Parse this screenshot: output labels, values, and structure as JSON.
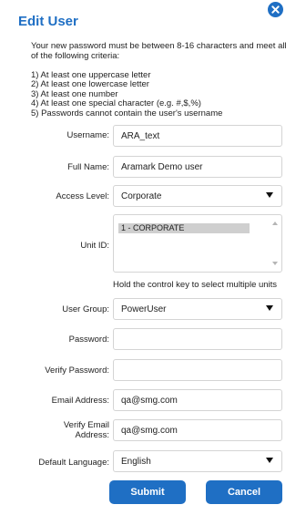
{
  "dialog": {
    "title": "Edit User",
    "intro": "Your new password must be between 8-16 characters and meet all of the following criteria:",
    "rules": [
      "1) At least one uppercase letter",
      "2) At least one lowercase letter",
      "3) At least one number",
      "4) At least one special character (e.g. #,$,%)",
      "5) Passwords cannot contain the user's username"
    ]
  },
  "form": {
    "username": {
      "label": "Username:",
      "value": "ARA_text"
    },
    "full_name": {
      "label": "Full Name:",
      "value": "Aramark Demo user"
    },
    "access_level": {
      "label": "Access Level:",
      "value": "Corporate"
    },
    "unit_id": {
      "label": "Unit ID:",
      "options": [
        "1 - CORPORATE"
      ],
      "hint": "Hold the control key to select multiple units"
    },
    "user_group": {
      "label": "User Group:",
      "value": "PowerUser"
    },
    "password": {
      "label": "Password:",
      "value": ""
    },
    "verify_password": {
      "label": "Verify Password:",
      "value": ""
    },
    "email": {
      "label": "Email Address:",
      "value": "qa@smg.com"
    },
    "verify_email": {
      "label_line1": "Verify Email",
      "label_line2": "Address:",
      "value": "qa@smg.com"
    },
    "default_language": {
      "label": "Default Language:",
      "value": "English"
    }
  },
  "buttons": {
    "submit": "Submit",
    "cancel": "Cancel"
  },
  "colors": {
    "accent": "#1f6fc4"
  },
  "icons": {
    "close": "close-circle-icon"
  }
}
